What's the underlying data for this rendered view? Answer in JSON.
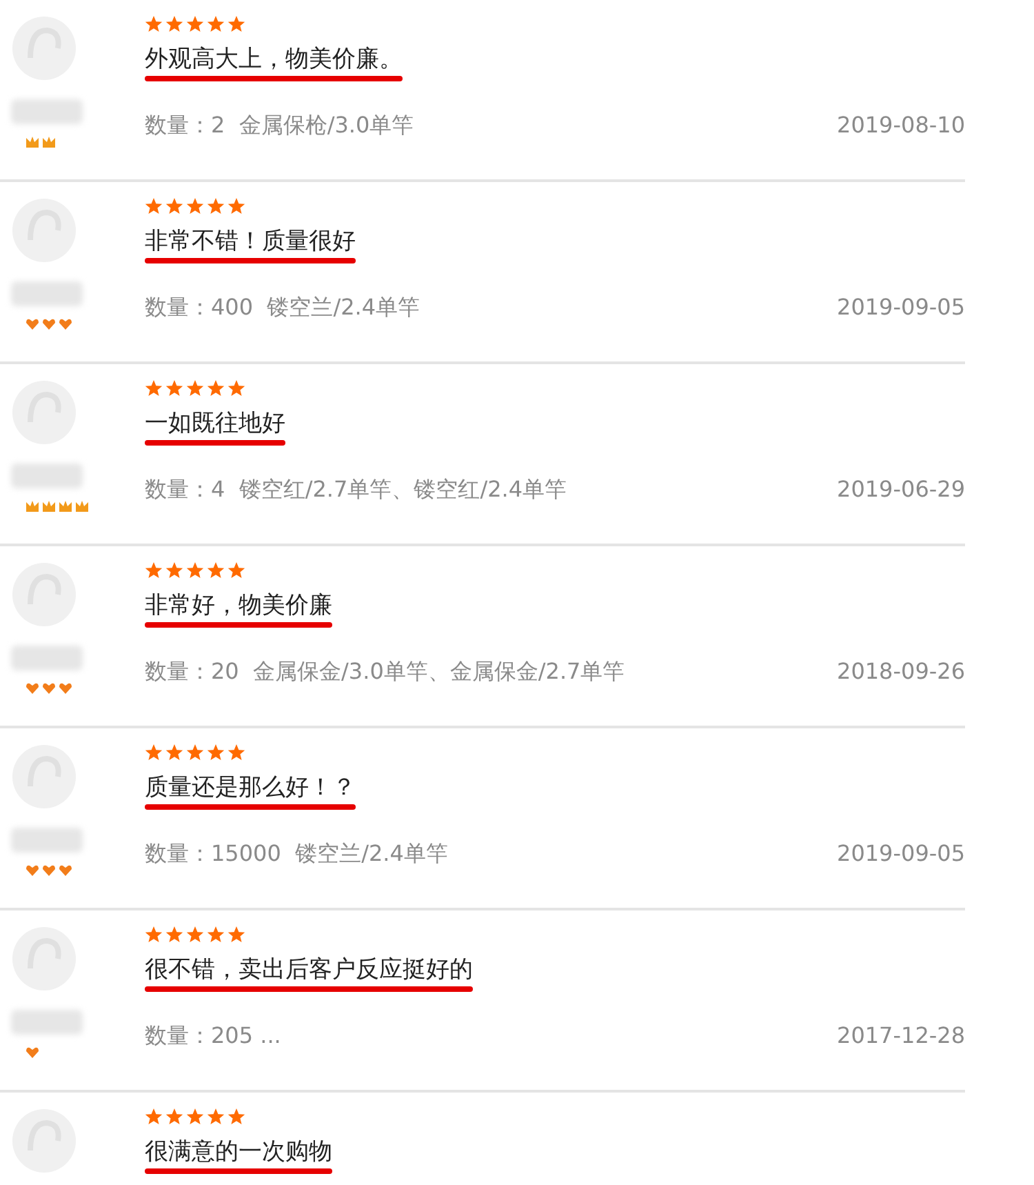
{
  "reviews": [
    {
      "stars": 5,
      "text": "外观高大上，物美价廉。",
      "quantity": "数量：2  金属保枪/3.0单竿",
      "date": "2019-08-10",
      "badges": [
        {
          "kind": "crown"
        },
        {
          "kind": "crown"
        }
      ]
    },
    {
      "stars": 5,
      "text": "非常不错！质量很好",
      "quantity": "数量：400  镂空兰/2.4单竿",
      "date": "2019-09-05",
      "badges": [
        {
          "kind": "heart"
        },
        {
          "kind": "heart"
        },
        {
          "kind": "heart"
        }
      ]
    },
    {
      "stars": 5,
      "text": "一如既往地好",
      "quantity": "数量：4  镂空红/2.7单竿、镂空红/2.4单竿",
      "date": "2019-06-29",
      "badges": [
        {
          "kind": "crown"
        },
        {
          "kind": "crown"
        },
        {
          "kind": "crown"
        },
        {
          "kind": "crown"
        }
      ]
    },
    {
      "stars": 5,
      "text": "非常好，物美价廉",
      "quantity": "数量：20  金属保金/3.0单竿、金属保金/2.7单竿",
      "date": "2018-09-26",
      "badges": [
        {
          "kind": "heart"
        },
        {
          "kind": "heart"
        },
        {
          "kind": "heart"
        }
      ]
    },
    {
      "stars": 5,
      "text": "质量还是那么好！？",
      "quantity": "数量：15000  镂空兰/2.4单竿",
      "date": "2019-09-05",
      "badges": [
        {
          "kind": "heart"
        },
        {
          "kind": "heart"
        },
        {
          "kind": "heart"
        }
      ]
    },
    {
      "stars": 5,
      "text": "很不错，卖出后客户反应挺好的",
      "quantity": "数量：205 ...",
      "date": "2017-12-28",
      "badges": [
        {
          "kind": "heart"
        }
      ]
    },
    {
      "stars": 5,
      "text": "很满意的一次购物"
    }
  ]
}
